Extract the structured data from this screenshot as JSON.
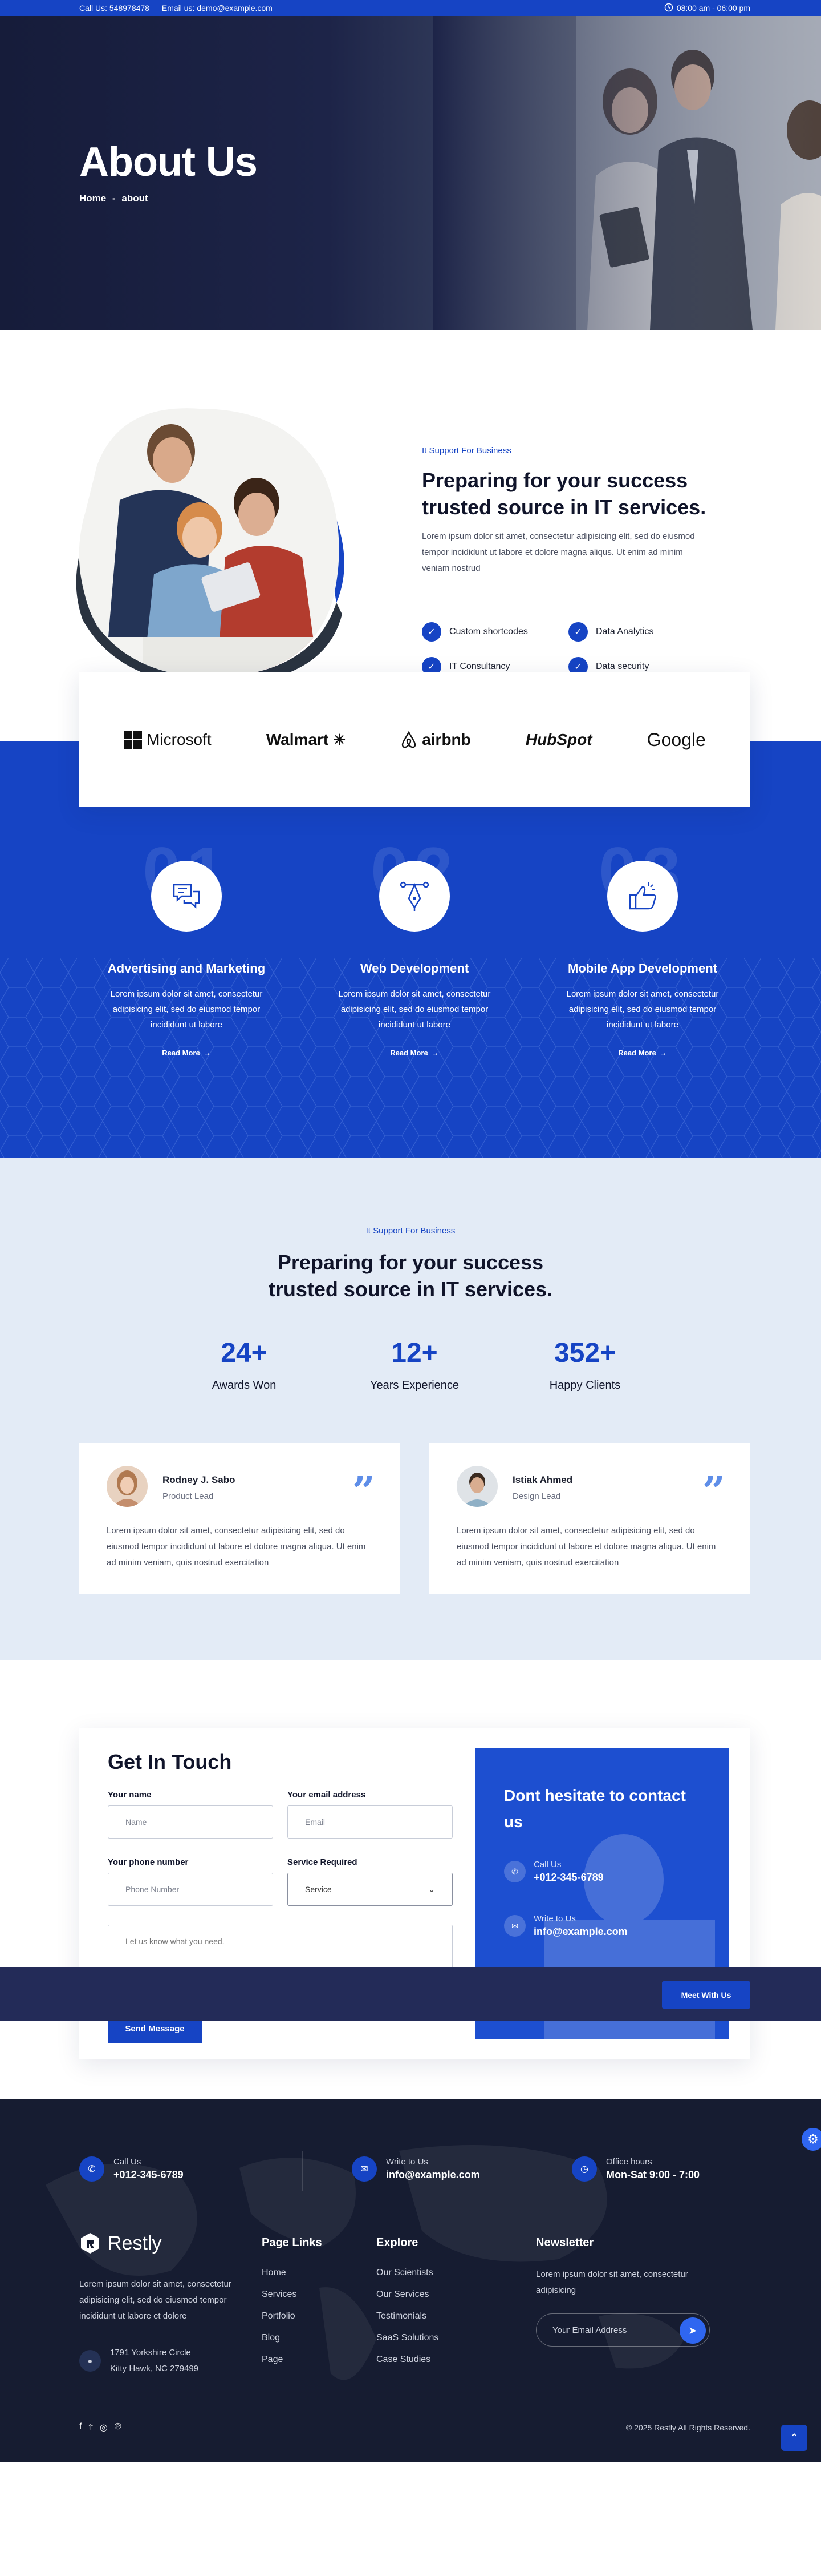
{
  "topbar": {
    "phone": "Call Us: 548978478",
    "email": "Email us: demo@example.com",
    "hours": "08:00 am - 06:00 pm"
  },
  "hero": {
    "title": "About Us",
    "crumb_home": "Home",
    "crumb_sep": "-",
    "crumb_current": "about"
  },
  "intro": {
    "tag": "It Support For Business",
    "title": "Preparing for your success trusted source in IT services.",
    "text": "Lorem ipsum dolor sit amet, consectetur adipisicing elit, sed do eiusmod tempor incididunt ut labore et dolore magna aliqus. Ut enim ad minim veniam nostrud",
    "features": [
      "Custom shortcodes",
      "Data Analytics",
      "IT Consultancy",
      "Data security"
    ]
  },
  "logos": [
    "Microsoft",
    "Walmart",
    "airbnb",
    "HubSpot",
    "Google"
  ],
  "services": [
    {
      "num": "01",
      "title": "Advertising and Marketing",
      "text": "Lorem ipsum dolor sit amet, consectetur adipisicing elit, sed do eiusmod tempor incididunt ut labore",
      "more": "Read More"
    },
    {
      "num": "02",
      "title": "Web Development",
      "text": "Lorem ipsum dolor sit amet, consectetur adipisicing elit, sed do eiusmod tempor incididunt ut labore",
      "more": "Read More"
    },
    {
      "num": "03",
      "title": "Mobile App Development",
      "text": "Lorem ipsum dolor sit amet, consectetur adipisicing elit, sed do eiusmod tempor incididunt ut labore",
      "more": "Read More"
    }
  ],
  "stats_section": {
    "tag": "It Support For Business",
    "title_line1": "Preparing for your success",
    "title_line2": "trusted source in IT services.",
    "stats": [
      {
        "value": "24+",
        "label": "Awards Won"
      },
      {
        "value": "12+",
        "label": "Years Experience"
      },
      {
        "value": "352+",
        "label": "Happy Clients"
      }
    ]
  },
  "testimonials": [
    {
      "name": "Rodney J. Sabo",
      "role": "Product Lead",
      "text": "Lorem ipsum dolor sit amet, consectetur adipisicing elit, sed do eiusmod tempor incididunt ut labore et dolore magna aliqua. Ut enim ad minim veniam, quis nostrud exercitation"
    },
    {
      "name": "Istiak Ahmed",
      "role": "Design Lead",
      "text": "Lorem ipsum dolor sit amet, consectetur adipisicing elit, sed do eiusmod tempor incididunt ut labore et dolore magna aliqua. Ut enim ad minim veniam, quis nostrud exercitation"
    }
  ],
  "contact": {
    "title": "Get In Touch",
    "name_label": "Your name",
    "name_placeholder": "Name",
    "email_label": "Your email address",
    "email_placeholder": "Email",
    "phone_label": "Your phone number",
    "phone_placeholder": "Phone Number",
    "service_label": "Service Required",
    "service_value": "Service",
    "message_placeholder": "Let us know what you need.",
    "send": "Send Message",
    "side_title": "Dont hesitate to contact us",
    "call_label": "Call Us",
    "call_value": "+012-345-6789",
    "write_label": "Write to Us",
    "write_value": "info@example.com",
    "banner_button": "Meet With Us"
  },
  "footer": {
    "call_label": "Call Us",
    "call_value": "+012-345-6789",
    "write_label": "Write to Us",
    "write_value": "info@example.com",
    "hours_label": "Office hours",
    "hours_value": "Mon-Sat 9:00 - 7:00",
    "brand": "Restly",
    "desc": "Lorem ipsum dolor sit amet, consectetur adipisicing elit, sed do eiusmod tempor incididunt ut labore et dolore",
    "addr1": "1791 Yorkshire Circle",
    "addr2": "Kitty Hawk, NC 279499",
    "page_links_title": "Page Links",
    "page_links": [
      "Home",
      "Services",
      "Portfolio",
      "Blog",
      "Page"
    ],
    "explore_title": "Explore",
    "explore": [
      "Our Scientists",
      "Our Services",
      "Testimonials",
      "SaaS Solutions",
      "Case Studies"
    ],
    "newsletter_title": "Newsletter",
    "newsletter_text": "Lorem ipsum dolor sit amet, consectetur adipisicing",
    "newsletter_placeholder": "Your Email Address",
    "copyright": "© 2025 Restly All Rights Reserved."
  }
}
